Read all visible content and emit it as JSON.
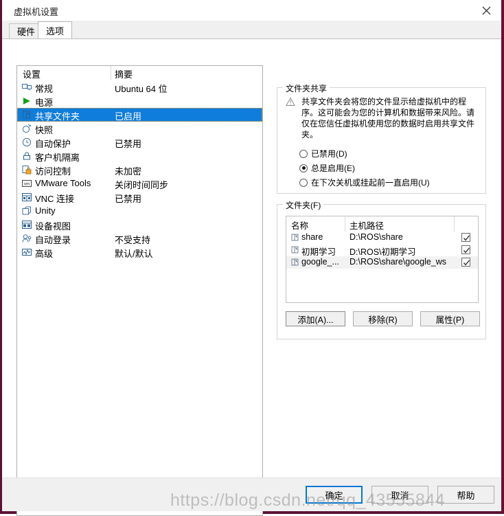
{
  "window": {
    "title": "虚拟机设置",
    "close_icon": "close-icon"
  },
  "tabs": [
    {
      "label": "硬件",
      "active": false
    },
    {
      "label": "选项",
      "active": true
    }
  ],
  "settings_list": {
    "header": {
      "name": "设置",
      "summary": "摘要"
    },
    "items": [
      {
        "icon": "monitor-icon",
        "label": "常规",
        "summary": "Ubuntu 64 位",
        "selected": false
      },
      {
        "icon": "play-green-icon",
        "label": "电源",
        "summary": "",
        "selected": false
      },
      {
        "icon": "shared-folder-icon",
        "label": "共享文件夹",
        "summary": "已启用",
        "selected": true
      },
      {
        "icon": "snapshot-icon",
        "label": "快照",
        "summary": "",
        "selected": false
      },
      {
        "icon": "clock-icon",
        "label": "自动保护",
        "summary": "已禁用",
        "selected": false
      },
      {
        "icon": "lock-icon",
        "label": "客户机隔离",
        "summary": "",
        "selected": false
      },
      {
        "icon": "access-lock-icon",
        "label": "访问控制",
        "summary": "未加密",
        "selected": false
      },
      {
        "icon": "vmware-tools-icon",
        "label": "VMware Tools",
        "summary": "关闭时间同步",
        "selected": false
      },
      {
        "icon": "vnc-icon",
        "label": "VNC 连接",
        "summary": "已禁用",
        "selected": false
      },
      {
        "icon": "unity-icon",
        "label": "Unity",
        "summary": "",
        "selected": false
      },
      {
        "icon": "device-view-icon",
        "label": "设备视图",
        "summary": "",
        "selected": false
      },
      {
        "icon": "auto-login-icon",
        "label": "自动登录",
        "summary": "不受支持",
        "selected": false
      },
      {
        "icon": "advanced-icon",
        "label": "高级",
        "summary": "默认/默认",
        "selected": false
      }
    ]
  },
  "folder_sharing": {
    "group_title": "文件夹共享",
    "warning_icon": "warning-triangle-icon",
    "warning_text": "共享文件夹会将您的文件显示给虚拟机中的程序。这可能会为您的计算机和数据带来风险。请仅在您信任虚拟机使用您的数据时启用共享文件夹。",
    "options": [
      {
        "label": "已禁用(D)",
        "selected": false
      },
      {
        "label": "总是启用(E)",
        "selected": true
      },
      {
        "label": "在下次关机或挂起前一直启用(U)",
        "selected": false
      }
    ]
  },
  "folders": {
    "group_title": "文件夹(F)",
    "columns": [
      "名称",
      "主机路径",
      ""
    ],
    "rows": [
      {
        "icon": "folder-icon",
        "name": "share",
        "path": "D:\\ROS\\share",
        "enabled": true
      },
      {
        "icon": "folder-icon",
        "name": "初期学习",
        "path": "D:\\ROS\\初期学习",
        "enabled": true
      },
      {
        "icon": "folder-icon",
        "name": "google_...",
        "path": "D:\\ROS\\share\\google_ws",
        "enabled": true
      }
    ],
    "buttons": [
      {
        "label": "添加(A)...",
        "focused": true
      },
      {
        "label": "移除(R)",
        "focused": false
      },
      {
        "label": "属性(P)",
        "focused": false
      }
    ]
  },
  "footer": {
    "buttons": [
      {
        "label": "确定",
        "default": true
      },
      {
        "label": "取消",
        "default": false
      },
      {
        "label": "帮助",
        "default": false
      }
    ]
  },
  "watermark": {
    "text": "https://blog.csdn.net/qq_43555844"
  },
  "colors": {
    "selection_blue": "#0f7ddb",
    "default_button_border": "#0078d7",
    "window_frame": "#5b1235",
    "dialog_face": "#f0f0f0"
  }
}
